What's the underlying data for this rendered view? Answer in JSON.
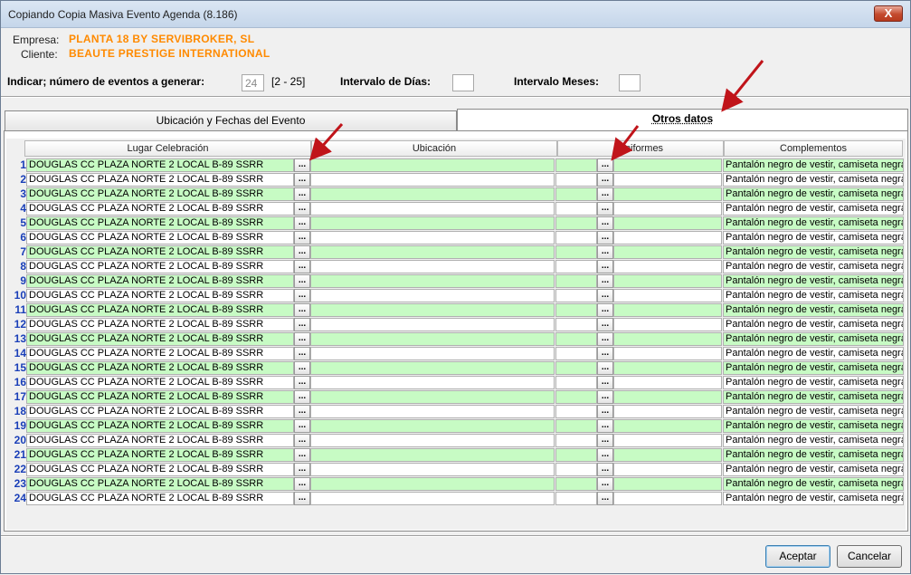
{
  "window": {
    "title": "Copiando Copia Masiva Evento Agenda (8.186)",
    "close_label": "X"
  },
  "info": {
    "empresa_label": "Empresa:",
    "empresa_value": "PLANTA 18 BY SERVIBROKER, SL",
    "cliente_label": "Cliente:",
    "cliente_value": "BEAUTE PRESTIGE INTERNATIONAL"
  },
  "params": {
    "num_label": "Indicar; número de eventos a generar:",
    "num_value": "24",
    "num_range": "[2 - 25]",
    "dias_label": "Intervalo de Días:",
    "dias_value": "",
    "meses_label": "Intervalo Meses:",
    "meses_value": ""
  },
  "tabs": [
    {
      "label": "Ubicación y Fechas del Evento"
    },
    {
      "label": "Otros datos"
    }
  ],
  "grid": {
    "headers": [
      "Lugar Celebración",
      "Ubicación",
      "Uniformes",
      "Complementos"
    ],
    "button_label": "...",
    "rows": [
      {
        "num": "1",
        "lugar": "DOUGLAS CC PLAZA NORTE 2 LOCAL B-89 SSRR",
        "ubicacion": "",
        "uniformes": "",
        "complementos": "Pantalón negro de vestir, camiseta negra,"
      },
      {
        "num": "2",
        "lugar": "DOUGLAS CC PLAZA NORTE 2 LOCAL B-89 SSRR",
        "ubicacion": "",
        "uniformes": "",
        "complementos": "Pantalón negro de vestir, camiseta negra,"
      },
      {
        "num": "3",
        "lugar": "DOUGLAS CC PLAZA NORTE 2 LOCAL B-89 SSRR",
        "ubicacion": "",
        "uniformes": "",
        "complementos": "Pantalón negro de vestir, camiseta negra,"
      },
      {
        "num": "4",
        "lugar": "DOUGLAS CC PLAZA NORTE 2 LOCAL B-89 SSRR",
        "ubicacion": "",
        "uniformes": "",
        "complementos": "Pantalón negro de vestir, camiseta negra,"
      },
      {
        "num": "5",
        "lugar": "DOUGLAS CC PLAZA NORTE 2 LOCAL B-89 SSRR",
        "ubicacion": "",
        "uniformes": "",
        "complementos": "Pantalón negro de vestir, camiseta negra,"
      },
      {
        "num": "6",
        "lugar": "DOUGLAS CC PLAZA NORTE 2 LOCAL B-89 SSRR",
        "ubicacion": "",
        "uniformes": "",
        "complementos": "Pantalón negro de vestir, camiseta negra,"
      },
      {
        "num": "7",
        "lugar": "DOUGLAS CC PLAZA NORTE 2 LOCAL B-89 SSRR",
        "ubicacion": "",
        "uniformes": "",
        "complementos": "Pantalón negro de vestir, camiseta negra,"
      },
      {
        "num": "8",
        "lugar": "DOUGLAS CC PLAZA NORTE 2 LOCAL B-89 SSRR",
        "ubicacion": "",
        "uniformes": "",
        "complementos": "Pantalón negro de vestir, camiseta negra,"
      },
      {
        "num": "9",
        "lugar": "DOUGLAS CC PLAZA NORTE 2 LOCAL B-89 SSRR",
        "ubicacion": "",
        "uniformes": "",
        "complementos": "Pantalón negro de vestir, camiseta negra,"
      },
      {
        "num": "10",
        "lugar": "DOUGLAS CC PLAZA NORTE 2 LOCAL B-89 SSRR",
        "ubicacion": "",
        "uniformes": "",
        "complementos": "Pantalón negro de vestir, camiseta negra,"
      },
      {
        "num": "11",
        "lugar": "DOUGLAS CC PLAZA NORTE 2 LOCAL B-89 SSRR",
        "ubicacion": "",
        "uniformes": "",
        "complementos": "Pantalón negro de vestir, camiseta negra,"
      },
      {
        "num": "12",
        "lugar": "DOUGLAS CC PLAZA NORTE 2 LOCAL B-89 SSRR",
        "ubicacion": "",
        "uniformes": "",
        "complementos": "Pantalón negro de vestir, camiseta negra,"
      },
      {
        "num": "13",
        "lugar": "DOUGLAS CC PLAZA NORTE 2 LOCAL B-89 SSRR",
        "ubicacion": "",
        "uniformes": "",
        "complementos": "Pantalón negro de vestir, camiseta negra,"
      },
      {
        "num": "14",
        "lugar": "DOUGLAS CC PLAZA NORTE 2 LOCAL B-89 SSRR",
        "ubicacion": "",
        "uniformes": "",
        "complementos": "Pantalón negro de vestir, camiseta negra,"
      },
      {
        "num": "15",
        "lugar": "DOUGLAS CC PLAZA NORTE 2 LOCAL B-89 SSRR",
        "ubicacion": "",
        "uniformes": "",
        "complementos": "Pantalón negro de vestir, camiseta negra,"
      },
      {
        "num": "16",
        "lugar": "DOUGLAS CC PLAZA NORTE 2 LOCAL B-89 SSRR",
        "ubicacion": "",
        "uniformes": "",
        "complementos": "Pantalón negro de vestir, camiseta negra,"
      },
      {
        "num": "17",
        "lugar": "DOUGLAS CC PLAZA NORTE 2 LOCAL B-89 SSRR",
        "ubicacion": "",
        "uniformes": "",
        "complementos": "Pantalón negro de vestir, camiseta negra,"
      },
      {
        "num": "18",
        "lugar": "DOUGLAS CC PLAZA NORTE 2 LOCAL B-89 SSRR",
        "ubicacion": "",
        "uniformes": "",
        "complementos": "Pantalón negro de vestir, camiseta negra,"
      },
      {
        "num": "19",
        "lugar": "DOUGLAS CC PLAZA NORTE 2 LOCAL B-89 SSRR",
        "ubicacion": "",
        "uniformes": "",
        "complementos": "Pantalón negro de vestir, camiseta negra,"
      },
      {
        "num": "20",
        "lugar": "DOUGLAS CC PLAZA NORTE 2 LOCAL B-89 SSRR",
        "ubicacion": "",
        "uniformes": "",
        "complementos": "Pantalón negro de vestir, camiseta negra,"
      },
      {
        "num": "21",
        "lugar": "DOUGLAS CC PLAZA NORTE 2 LOCAL B-89 SSRR",
        "ubicacion": "",
        "uniformes": "",
        "complementos": "Pantalón negro de vestir, camiseta negra,"
      },
      {
        "num": "22",
        "lugar": "DOUGLAS CC PLAZA NORTE 2 LOCAL B-89 SSRR",
        "ubicacion": "",
        "uniformes": "",
        "complementos": "Pantalón negro de vestir, camiseta negra,"
      },
      {
        "num": "23",
        "lugar": "DOUGLAS CC PLAZA NORTE 2 LOCAL B-89 SSRR",
        "ubicacion": "",
        "uniformes": "",
        "complementos": "Pantalón negro de vestir, camiseta negra,"
      },
      {
        "num": "24",
        "lugar": "DOUGLAS CC PLAZA NORTE 2 LOCAL B-89 SSRR",
        "ubicacion": "",
        "uniformes": "",
        "complementos": "Pantalón negro de vestir, camiseta negra,"
      }
    ]
  },
  "buttons": {
    "accept": "Aceptar",
    "cancel": "Cancelar"
  },
  "colors": {
    "highlight_row": "#c7fbc4",
    "accent_text": "#ff8a00",
    "row_number": "#1a3fb8",
    "annotation_arrow": "#c0141a"
  }
}
